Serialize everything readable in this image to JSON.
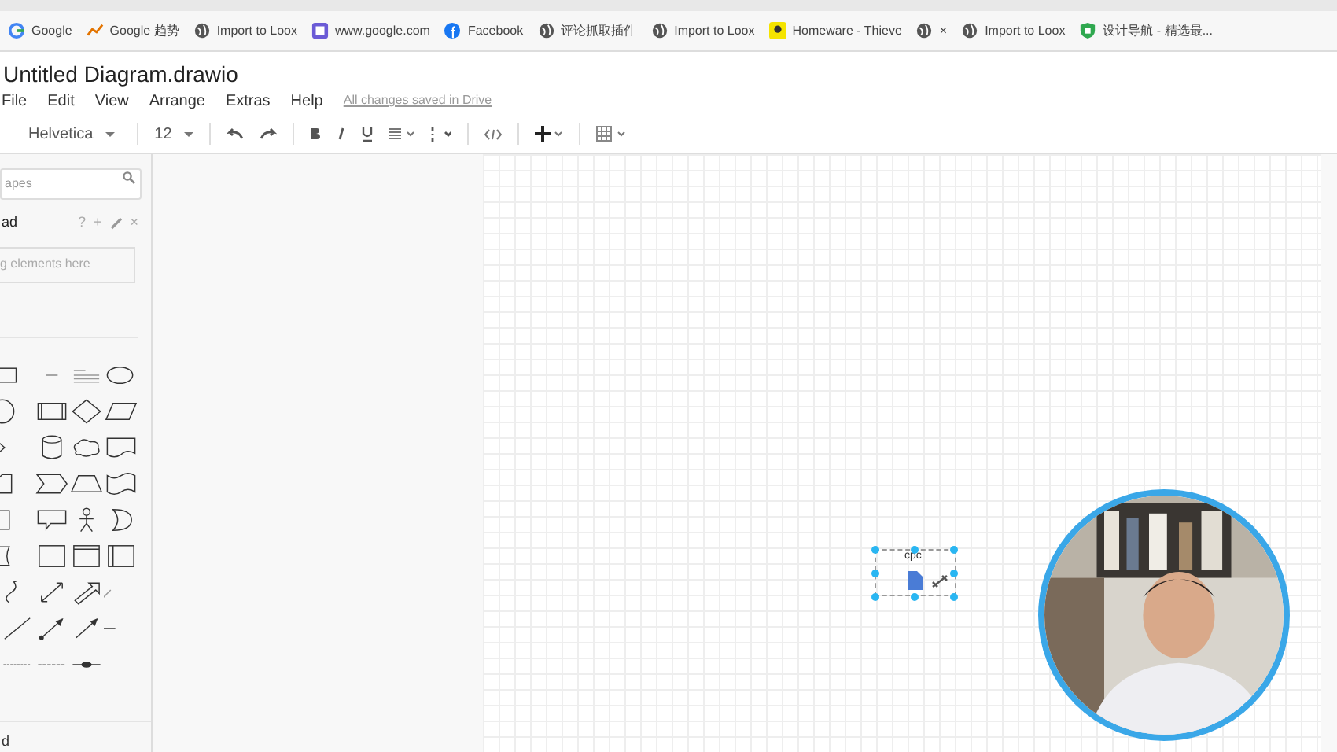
{
  "bookmarks": [
    {
      "label": "Google"
    },
    {
      "label": "Google 趋势"
    },
    {
      "label": "Import to Loox"
    },
    {
      "label": "www.google.com"
    },
    {
      "label": "Facebook"
    },
    {
      "label": "评论抓取插件"
    },
    {
      "label": "Import to Loox"
    },
    {
      "label": "Homeware - Thieve"
    },
    {
      "label": "×"
    },
    {
      "label": "Import to Loox"
    },
    {
      "label": "设计导航 - 精选最..."
    }
  ],
  "title": "Untitled Diagram.drawio",
  "menu": [
    "File",
    "Edit",
    "View",
    "Arrange",
    "Extras",
    "Help"
  ],
  "save_status": "All changes saved in Drive",
  "toolbar": {
    "font": "Helvetica",
    "size": "12"
  },
  "sidebar": {
    "search_placeholder": "apes",
    "scratchpad": {
      "title": "ad",
      "help": "?",
      "add": "+",
      "close": "×",
      "hint": "g elements here"
    },
    "footer": "d"
  },
  "canvas": {
    "shape_label": "cpc",
    "shape_selected": true
  }
}
